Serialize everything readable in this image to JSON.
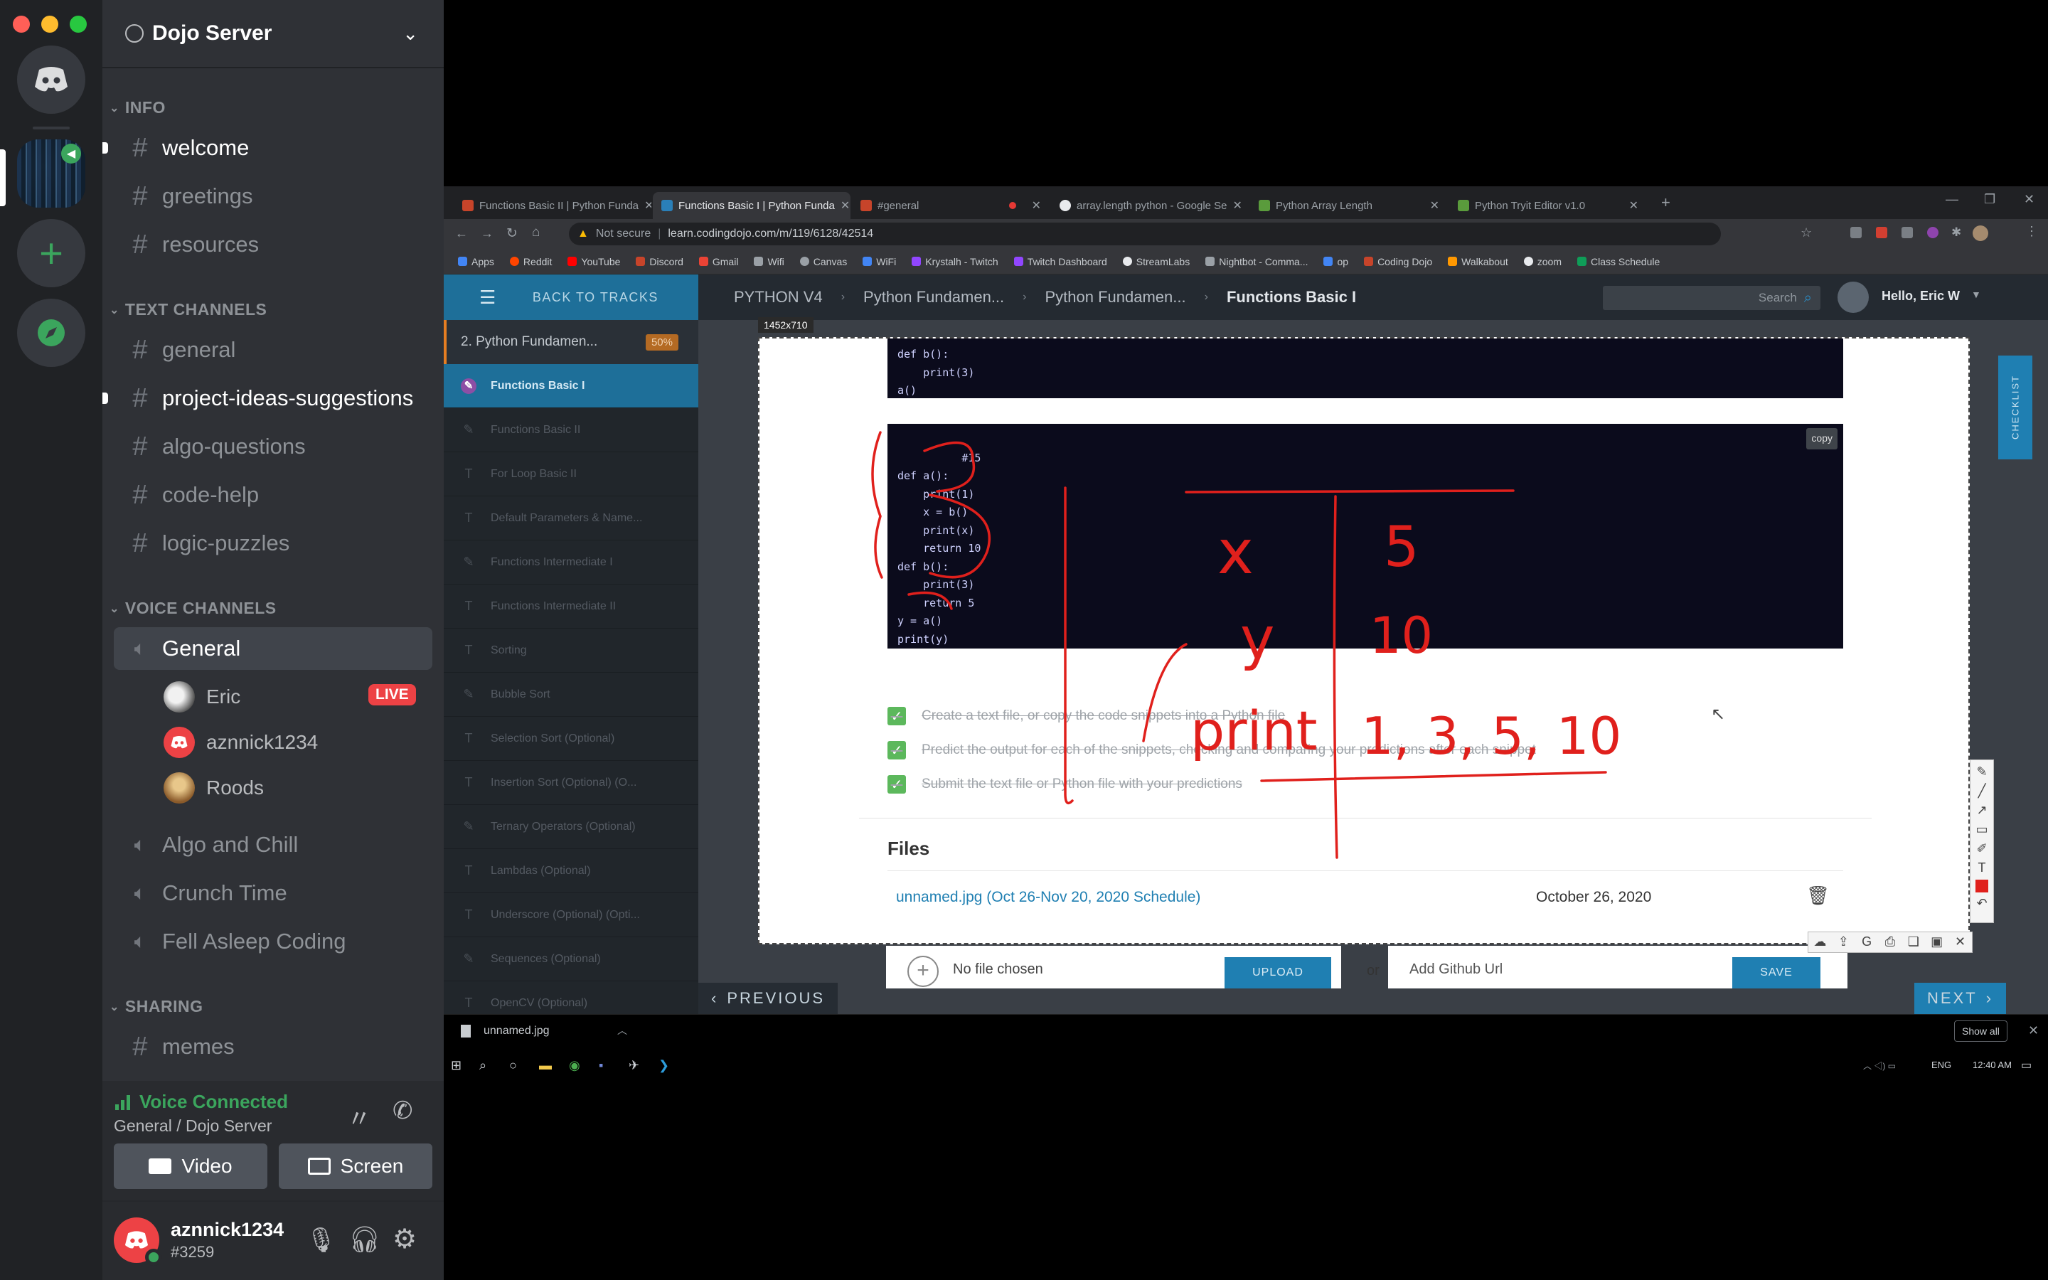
{
  "window": {
    "traffic_lights": [
      "#ff5f57",
      "#febc2e",
      "#28c840"
    ]
  },
  "rail": {
    "add_server_icon": "plus-icon",
    "explore_icon": "compass-icon"
  },
  "server": {
    "name": "Dojo Server"
  },
  "categories": {
    "info": "INFO",
    "text": "TEXT CHANNELS",
    "voice": "VOICE CHANNELS",
    "sharing": "SHARING"
  },
  "info_channels": [
    {
      "name": "welcome"
    },
    {
      "name": "greetings"
    },
    {
      "name": "resources"
    }
  ],
  "text_channels": [
    {
      "name": "general"
    },
    {
      "name": "project-ideas-suggestions"
    },
    {
      "name": "algo-questions"
    },
    {
      "name": "code-help"
    },
    {
      "name": "logic-puzzles"
    }
  ],
  "voice_channels": [
    {
      "name": "General"
    },
    {
      "name": "Algo and Chill"
    },
    {
      "name": "Crunch Time"
    },
    {
      "name": "Fell Asleep Coding"
    }
  ],
  "voice_users": [
    {
      "name": "Eric",
      "live": "LIVE"
    },
    {
      "name": "aznnick1234"
    },
    {
      "name": "Roods"
    }
  ],
  "sharing_channels": [
    {
      "name": "memes"
    }
  ],
  "voice_status": {
    "title": "Voice Connected",
    "location": "General / Dojo Server",
    "video_label": "Video",
    "screen_label": "Screen"
  },
  "user": {
    "name": "aznnick1234",
    "tag": "#3259"
  },
  "browser": {
    "tabs": [
      "Functions Basic II | Python Funda",
      "Functions Basic I | Python Funda",
      "#general",
      "array.length python - Google Se",
      "Python Array Length",
      "Python Tryit Editor v1.0"
    ],
    "not_secure": "Not secure",
    "url": "learn.codingdojo.com/m/119/6128/42514",
    "bookmarks": [
      "Apps",
      "Reddit",
      "YouTube",
      "Discord",
      "Gmail",
      "Wifi",
      "Canvas",
      "WiFi",
      "Krystalh - Twitch",
      "Twitch Dashboard",
      "StreamLabs",
      "Nightbot - Comma...",
      "op",
      "Coding Dojo",
      "Walkabout",
      "zoom",
      "Class Schedule"
    ]
  },
  "site": {
    "back_to_tracks": "BACK TO TRACKS",
    "course": "2. Python Fundamen...",
    "progress": "50%",
    "menu": [
      "Functions Basic I",
      "Functions Basic II",
      "For Loop Basic II",
      "Default Parameters & Name...",
      "Functions Intermediate I",
      "Functions Intermediate II",
      "Sorting",
      "Bubble Sort",
      "Selection Sort (Optional)",
      "Insertion Sort (Optional) (O...",
      "Ternary Operators (Optional)",
      "Lambdas (Optional)",
      "Underscore (Optional) (Opti...",
      "Sequences (Optional)",
      "OpenCV (Optional)"
    ],
    "breadcrumbs": [
      "PYTHON V4",
      "Python Fundamen...",
      "Python Fundamen...",
      "Functions Basic I"
    ],
    "search_placeholder": "Search",
    "greeting": "Hello, Eric W",
    "checklist": "CHECKLIST",
    "selection_size": "1452x710",
    "code_top": "def b():\n    print(3)\na()",
    "code_main": "#15\ndef a():\n    print(1)\n    x = b()\n    print(x)\n    return 10\ndef b():\n    print(3)\n    return 5\ny = a()\nprint(y)",
    "copy_label": "copy",
    "tasks": [
      "Create a text file, or copy the code snippets into a Python file",
      "Predict the output for each of the snippets, checking and comparing your predictions after each snippet",
      "Submit the text file or Python file with your predictions"
    ],
    "files_heading": "Files",
    "file_name": "unnamed.jpg (Oct 26-Nov 20, 2020 Schedule)",
    "file_date": "October 26, 2020",
    "no_file": "No file chosen",
    "upload": "UPLOAD",
    "or": "or",
    "github_placeholder": "Add Github Url",
    "save": "SAVE",
    "previous": "PREVIOUS",
    "next": "NEXT",
    "annotation_color": "#e0201c",
    "handwriting": {
      "x": "x",
      "five": "5",
      "y": "y",
      "ten": "10",
      "print": "print",
      "output": "1, 3, 5, 10"
    }
  },
  "downloads": {
    "file": "unnamed.jpg",
    "show_all": "Show all"
  },
  "taskbar": {
    "lang": "ENG",
    "time": "12:40 AM"
  }
}
